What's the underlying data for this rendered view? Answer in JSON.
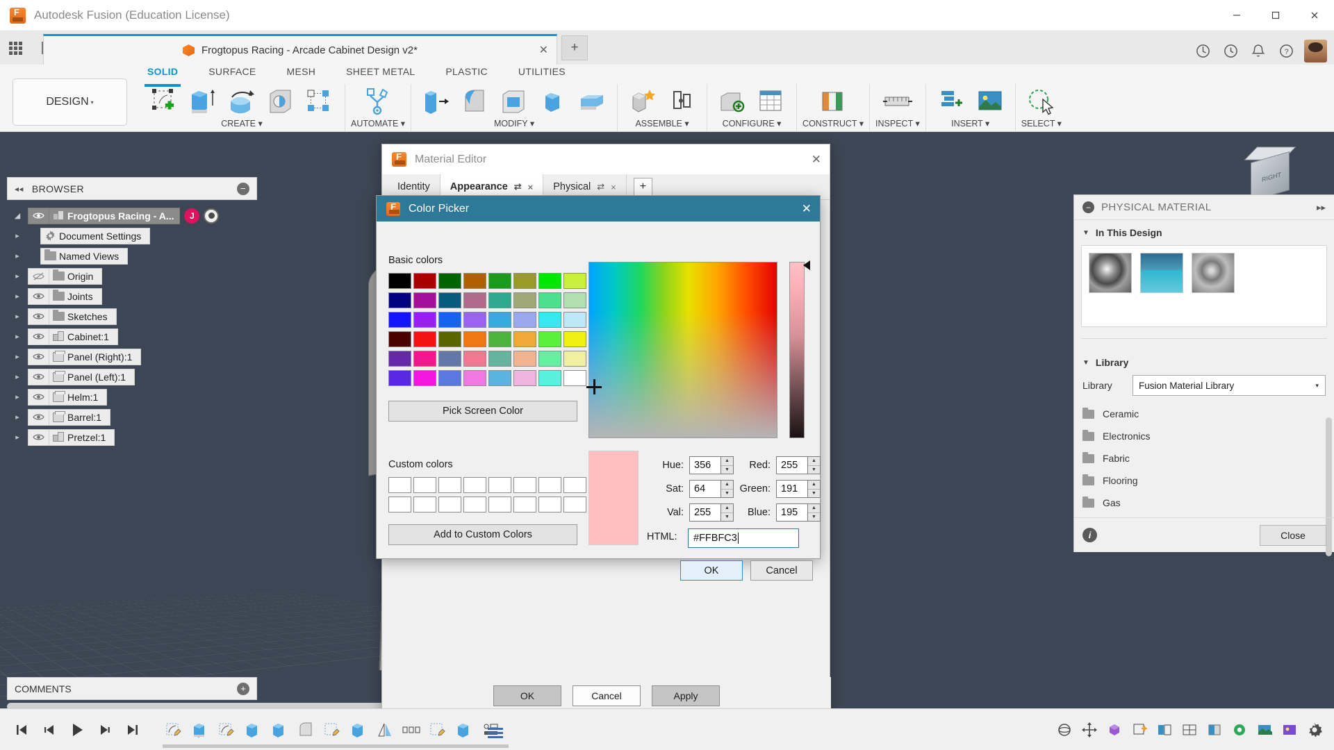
{
  "window": {
    "app_title": "Autodesk Fusion (Education License)",
    "minimize": "—",
    "maximize": "□",
    "close": "✕"
  },
  "quick_access": {
    "app_grid": "app-grid",
    "new_doc": "new-document",
    "save": "save",
    "undo": "undo",
    "redo": "redo"
  },
  "document_tab": {
    "title": "Frogtopus Racing - Arcade Cabinet Design v2*",
    "close": "✕",
    "add_tab": "+"
  },
  "ribbon": {
    "workspace": "DESIGN",
    "workspace_caret": "▾",
    "tabs": [
      {
        "label": "SOLID",
        "active": true
      },
      {
        "label": "SURFACE",
        "active": false
      },
      {
        "label": "MESH",
        "active": false
      },
      {
        "label": "SHEET METAL",
        "active": false
      },
      {
        "label": "PLASTIC",
        "active": false
      },
      {
        "label": "UTILITIES",
        "active": false
      }
    ],
    "panels": [
      {
        "title": "CREATE ▾"
      },
      {
        "title": "AUTOMATE ▾"
      },
      {
        "title": "MODIFY ▾"
      },
      {
        "title": "ASSEMBLE ▾"
      },
      {
        "title": "CONFIGURE ▾"
      },
      {
        "title": "CONSTRUCT ▾"
      },
      {
        "title": "INSPECT ▾"
      },
      {
        "title": "INSERT ▾"
      },
      {
        "title": "SELECT ▾"
      }
    ]
  },
  "browser": {
    "title": "BROWSER",
    "collapse": "◂◂",
    "minimize": "−",
    "root": {
      "label": "Frogtopus Racing - A...",
      "badge": "J"
    },
    "items": [
      {
        "label": "Document Settings",
        "icon": "gear-icon",
        "hidden": false
      },
      {
        "label": "Named Views",
        "icon": "folder-icon",
        "hidden": false
      },
      {
        "label": "Origin",
        "icon": "folder-icon",
        "hidden": true
      },
      {
        "label": "Joints",
        "icon": "folder-icon",
        "hidden": false
      },
      {
        "label": "Sketches",
        "icon": "folder-icon",
        "hidden": false
      },
      {
        "label": "Cabinet:1",
        "icon": "component-icon",
        "hidden": false
      },
      {
        "label": "Panel (Right):1",
        "icon": "body-icon",
        "hidden": false
      },
      {
        "label": "Panel (Left):1",
        "icon": "body-icon",
        "hidden": false
      },
      {
        "label": "Helm:1",
        "icon": "body-icon",
        "hidden": false
      },
      {
        "label": "Barrel:1",
        "icon": "body-icon",
        "hidden": false
      },
      {
        "label": "Pretzel:1",
        "icon": "component-icon",
        "hidden": false
      }
    ]
  },
  "comments": {
    "title": "COMMENTS",
    "add": "+"
  },
  "viewcube": {
    "face_label": "RIGHT"
  },
  "physical_material_panel": {
    "header": "PHYSICAL MATERIAL",
    "collapse_icon": "−",
    "expand_icon": "▸▸",
    "in_this_design": {
      "title": "In This Design",
      "triangle": "▼"
    },
    "library": {
      "title": "Library",
      "triangle": "▼",
      "field_label": "Library",
      "selected": "Fusion Material Library",
      "chevron": "▾",
      "items": [
        "Ceramic",
        "Electronics",
        "Fabric",
        "Flooring",
        "Gas"
      ]
    },
    "info_icon": "i",
    "close_label": "Close"
  },
  "material_editor": {
    "title": "Material Editor",
    "close": "✕",
    "tabs": [
      {
        "label": "Identity",
        "active": false,
        "has_controls": false
      },
      {
        "label": "Appearance",
        "active": true,
        "has_controls": true,
        "swap": "⇄",
        "close": "×"
      },
      {
        "label": "Physical",
        "active": false,
        "has_controls": true,
        "swap": "⇄",
        "close": "×"
      }
    ],
    "add_tab": "+",
    "buttons": {
      "ok": "OK",
      "cancel": "Cancel",
      "apply": "Apply"
    }
  },
  "color_picker": {
    "title": "Color Picker",
    "close": "✕",
    "basic_colors_label": "Basic colors",
    "basic_colors": [
      "#000000",
      "#a80000",
      "#006400",
      "#b06000",
      "#1a9c1a",
      "#9a9a28",
      "#00e800",
      "#c8f03c",
      "#000080",
      "#a0109c",
      "#065a7c",
      "#b26a8c",
      "#2fa890",
      "#a0a878",
      "#4de08c",
      "#b0e0b0",
      "#1414ff",
      "#9a1ef0",
      "#1464f0",
      "#9a64f0",
      "#38a8e0",
      "#9aa8f0",
      "#38e8f0",
      "#bce8f8",
      "#4c0000",
      "#f01414",
      "#5a6400",
      "#f07814",
      "#4cb43c",
      "#f0a838",
      "#5af03c",
      "#f0f014",
      "#6428a8",
      "#f0188c",
      "#6478a8",
      "#f07890",
      "#64b4a0",
      "#f0b490",
      "#64f0a0",
      "#f0f0a0",
      "#5a28e0",
      "#f018e0",
      "#5a78e0",
      "#f078e0",
      "#5ab4e0",
      "#f0b4e0",
      "#5af0e0",
      "#ffffff"
    ],
    "pick_screen_color": "Pick Screen Color",
    "custom_colors_label": "Custom colors",
    "custom_colors": [
      "#ffffff",
      "#ffffff",
      "#ffffff",
      "#ffffff",
      "#ffffff",
      "#ffffff",
      "#ffffff",
      "#ffffff",
      "#ffffff",
      "#ffffff",
      "#ffffff",
      "#ffffff",
      "#ffffff",
      "#ffffff",
      "#ffffff",
      "#ffffff"
    ],
    "add_to_custom_colors": "Add to Custom Colors",
    "preview_color": "#FFBFC3",
    "fields": {
      "hue": {
        "label": "Hue:",
        "value": "356"
      },
      "sat": {
        "label": "Sat:",
        "value": "64"
      },
      "val": {
        "label": "Val:",
        "value": "255"
      },
      "red": {
        "label": "Red:",
        "value": "255"
      },
      "green": {
        "label": "Green:",
        "value": "191"
      },
      "blue": {
        "label": "Blue:",
        "value": "195"
      },
      "html": {
        "label": "HTML:",
        "value": "#FFBFC3"
      }
    },
    "buttons": {
      "ok": "OK",
      "cancel": "Cancel"
    },
    "spin_up": "▲",
    "spin_down": "▼"
  },
  "status_bar": {
    "playback": [
      "skip-start",
      "step-back",
      "play",
      "step-forward",
      "skip-end"
    ],
    "timeline_count": 12
  }
}
